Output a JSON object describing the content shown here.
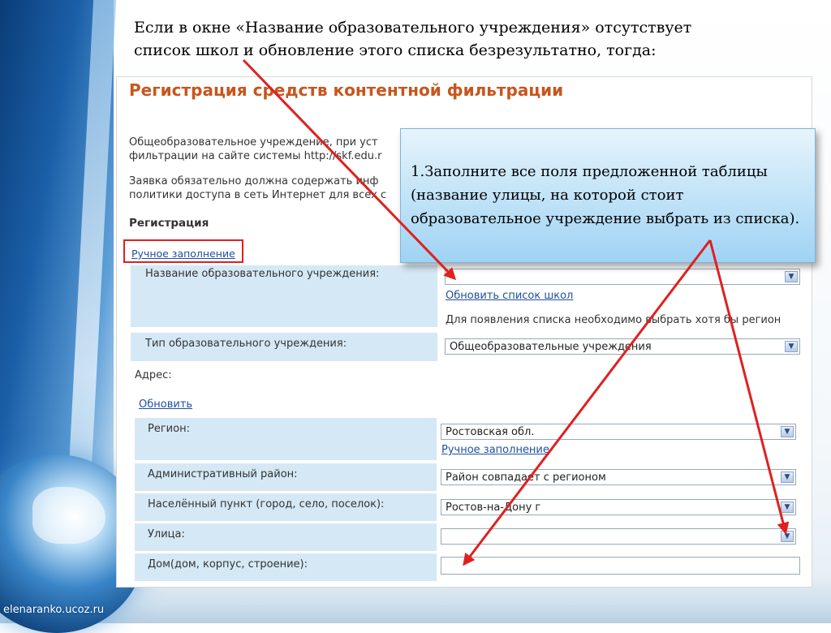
{
  "slide": {
    "instruction": "Если в окне «Название образовательного учреждения» отсутствует список школ и обновление этого списка безрезультатно, тогда:",
    "site_credit": "elenaranko.ucoz.ru"
  },
  "form": {
    "title": "Регистрация средств контентной фильтрации",
    "paragraph1_line1": "Общеобразовательное учреждение, при уст",
    "paragraph1_line2": "фильтрации на сайте системы http://skf.edu.r",
    "paragraph2_line1": "Заявка обязательно должна содержать инф",
    "paragraph2_line2": "политики доступа в сеть Интернет для всех с",
    "registration_heading": "Регистрация",
    "manual_fill_link": "Ручное заполнение",
    "institution": {
      "label": "Название образовательного учреждения:",
      "value": "",
      "refresh_link": "Обновить список школ",
      "hint": "Для появления списка необходимо выбрать хотя бы регион"
    },
    "institution_type": {
      "label": "Тип образовательного учреждения:",
      "value": "Общеобразовательные учреждения"
    },
    "address_label": "Адрес:",
    "refresh_address_link": "Обновить",
    "region": {
      "label": "Регион:",
      "value": "Ростовская обл.",
      "manual_link": "Ручное заполнение"
    },
    "district": {
      "label": "Административный район:",
      "value": "Район совпадает с регионом"
    },
    "locality": {
      "label": "Населённый пункт (город, село, поселок):",
      "value": "Ростов-на-Дону г"
    },
    "street": {
      "label": "Улица:",
      "value": ""
    },
    "house": {
      "label": "Дом(дом, корпус, строение):",
      "value": ""
    }
  },
  "callout": {
    "text": "1.Заполните все поля предложенной таблицы (название улицы, на которой стоит образовательное учреждение выбрать из списка)."
  },
  "colors": {
    "title": "#c8551d",
    "link": "#1f4fa0",
    "row_bg": "#d5e8f5",
    "arrow": "#e02020"
  }
}
